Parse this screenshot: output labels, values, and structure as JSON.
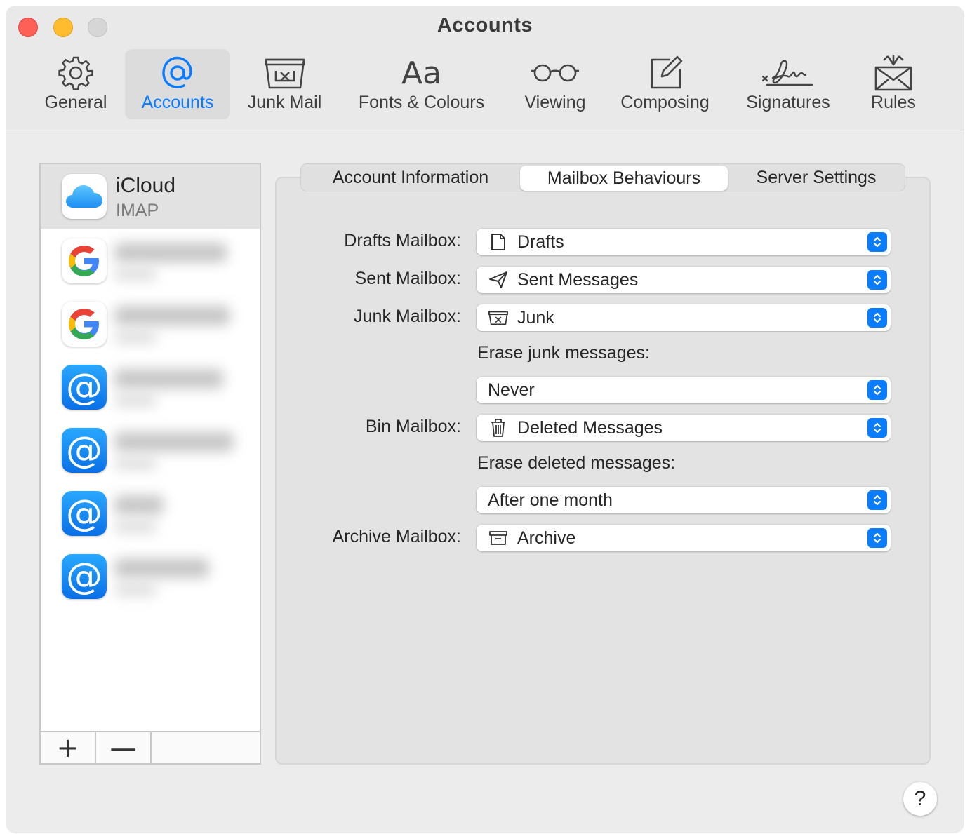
{
  "window": {
    "title": "Accounts"
  },
  "toolbar": {
    "items": [
      {
        "label": "General",
        "icon": "gear-icon"
      },
      {
        "label": "Accounts",
        "icon": "at-sign-icon",
        "selected": true
      },
      {
        "label": "Junk Mail",
        "icon": "junk-box-icon"
      },
      {
        "label": "Fonts & Colours",
        "icon": "font-aa-icon"
      },
      {
        "label": "Viewing",
        "icon": "glasses-icon"
      },
      {
        "label": "Composing",
        "icon": "compose-icon"
      },
      {
        "label": "Signatures",
        "icon": "signature-icon"
      },
      {
        "label": "Rules",
        "icon": "rules-envelope-icon"
      }
    ],
    "accent_color": "#0a7cff"
  },
  "sidebar": {
    "selected_account": {
      "name": "iCloud",
      "type": "IMAP",
      "icon": "icloud-icon"
    },
    "other_accounts": [
      {
        "icon": "google-icon"
      },
      {
        "icon": "google-icon"
      },
      {
        "icon": "at-sign-app-icon"
      },
      {
        "icon": "at-sign-app-icon"
      },
      {
        "icon": "at-sign-app-icon"
      },
      {
        "icon": "at-sign-app-icon"
      }
    ],
    "add_label": "+",
    "remove_label": "—"
  },
  "tabs": {
    "items": [
      "Account Information",
      "Mailbox Behaviours",
      "Server Settings"
    ],
    "selected": "Mailbox Behaviours"
  },
  "mailbox": {
    "drafts_label": "Drafts Mailbox:",
    "drafts_value": "Drafts",
    "sent_label": "Sent Mailbox:",
    "sent_value": "Sent Messages",
    "junk_label": "Junk Mailbox:",
    "junk_value": "Junk",
    "erase_junk_label": "Erase junk messages:",
    "erase_junk_value": "Never",
    "bin_label": "Bin Mailbox:",
    "bin_value": "Deleted Messages",
    "erase_deleted_label": "Erase deleted messages:",
    "erase_deleted_value": "After one month",
    "archive_label": "Archive Mailbox:",
    "archive_value": "Archive"
  },
  "help_label": "?"
}
